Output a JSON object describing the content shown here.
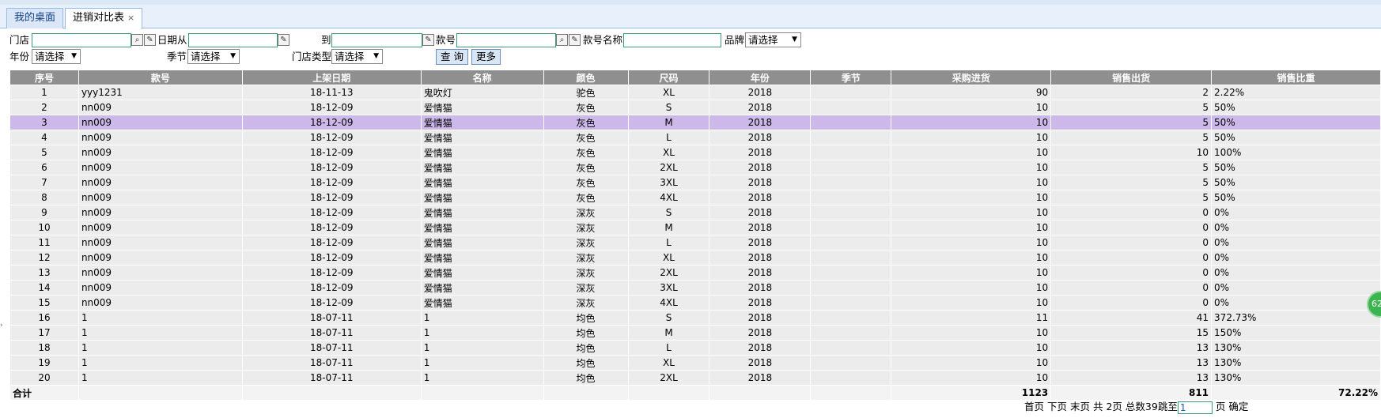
{
  "tabs": [
    {
      "label": "我的桌面"
    },
    {
      "label": "进销对比表",
      "close": "×"
    }
  ],
  "filters": {
    "store_label": "门店",
    "date_from_label": "日期从",
    "date_to_label": "到",
    "style_no_label": "款号",
    "style_name_label": "款号名称",
    "brand_label": "品牌",
    "brand_value": "请选择",
    "year_label": "年份",
    "year_value": "请选择",
    "season_label": "季节",
    "season_value": "请选择",
    "store_type_label": "门店类型",
    "store_type_value": "请选择",
    "query_button": "查 询",
    "more_button": "更多"
  },
  "table": {
    "columns": [
      "序号",
      "款号",
      "上架日期",
      "名称",
      "颜色",
      "尺码",
      "年份",
      "季节",
      "采购进货",
      "销售出货",
      "销售比重"
    ],
    "rows": [
      [
        "1",
        "yyy1231",
        "18-11-13",
        "鬼吹灯",
        "驼色",
        "XL",
        "2018",
        "",
        "90",
        "2",
        "2.22%"
      ],
      [
        "2",
        "nn009",
        "18-12-09",
        "爱情猫",
        "灰色",
        "S",
        "2018",
        "",
        "10",
        "5",
        "50%"
      ],
      [
        "3",
        "nn009",
        "18-12-09",
        "爱情猫",
        "灰色",
        "M",
        "2018",
        "",
        "10",
        "5",
        "50%"
      ],
      [
        "4",
        "nn009",
        "18-12-09",
        "爱情猫",
        "灰色",
        "L",
        "2018",
        "",
        "10",
        "5",
        "50%"
      ],
      [
        "5",
        "nn009",
        "18-12-09",
        "爱情猫",
        "灰色",
        "XL",
        "2018",
        "",
        "10",
        "10",
        "100%"
      ],
      [
        "6",
        "nn009",
        "18-12-09",
        "爱情猫",
        "灰色",
        "2XL",
        "2018",
        "",
        "10",
        "5",
        "50%"
      ],
      [
        "7",
        "nn009",
        "18-12-09",
        "爱情猫",
        "灰色",
        "3XL",
        "2018",
        "",
        "10",
        "5",
        "50%"
      ],
      [
        "8",
        "nn009",
        "18-12-09",
        "爱情猫",
        "灰色",
        "4XL",
        "2018",
        "",
        "10",
        "5",
        "50%"
      ],
      [
        "9",
        "nn009",
        "18-12-09",
        "爱情猫",
        "深灰",
        "S",
        "2018",
        "",
        "10",
        "0",
        "0%"
      ],
      [
        "10",
        "nn009",
        "18-12-09",
        "爱情猫",
        "深灰",
        "M",
        "2018",
        "",
        "10",
        "0",
        "0%"
      ],
      [
        "11",
        "nn009",
        "18-12-09",
        "爱情猫",
        "深灰",
        "L",
        "2018",
        "",
        "10",
        "0",
        "0%"
      ],
      [
        "12",
        "nn009",
        "18-12-09",
        "爱情猫",
        "深灰",
        "XL",
        "2018",
        "",
        "10",
        "0",
        "0%"
      ],
      [
        "13",
        "nn009",
        "18-12-09",
        "爱情猫",
        "深灰",
        "2XL",
        "2018",
        "",
        "10",
        "0",
        "0%"
      ],
      [
        "14",
        "nn009",
        "18-12-09",
        "爱情猫",
        "深灰",
        "3XL",
        "2018",
        "",
        "10",
        "0",
        "0%"
      ],
      [
        "15",
        "nn009",
        "18-12-09",
        "爱情猫",
        "深灰",
        "4XL",
        "2018",
        "",
        "10",
        "0",
        "0%"
      ],
      [
        "16",
        "1",
        "18-07-11",
        "1",
        "均色",
        "S",
        "2018",
        "",
        "11",
        "41",
        "372.73%"
      ],
      [
        "17",
        "1",
        "18-07-11",
        "1",
        "均色",
        "M",
        "2018",
        "",
        "10",
        "15",
        "150%"
      ],
      [
        "18",
        "1",
        "18-07-11",
        "1",
        "均色",
        "L",
        "2018",
        "",
        "10",
        "13",
        "130%"
      ],
      [
        "19",
        "1",
        "18-07-11",
        "1",
        "均色",
        "XL",
        "2018",
        "",
        "10",
        "13",
        "130%"
      ],
      [
        "20",
        "1",
        "18-07-11",
        "1",
        "均色",
        "2XL",
        "2018",
        "",
        "10",
        "13",
        "130%"
      ]
    ],
    "selected_row": 2,
    "total": {
      "label": "合计",
      "purchase": "1123",
      "sales": "811",
      "ratio": "72.22%"
    }
  },
  "pager": {
    "first": "首页",
    "next": "下页",
    "last": "末页",
    "pages": "共 2页",
    "count": "总数39",
    "jump_label": "跳至",
    "jump_value": "1",
    "page_suffix": "页",
    "confirm": "确定"
  },
  "float_badge": "62",
  "colors": {
    "header_bg": "#8f8f8f",
    "row_bg": "#ececec",
    "selected_row_bg": "#cdb8ea",
    "tab_border": "#99bbe8"
  }
}
